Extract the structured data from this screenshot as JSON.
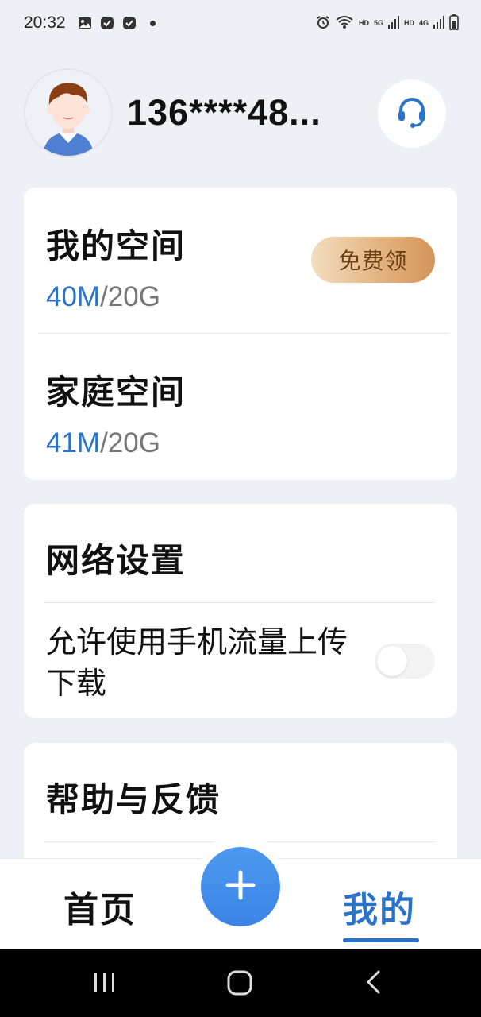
{
  "status_bar": {
    "time": "20:32",
    "right_labels": [
      "HD",
      "5G",
      "HD",
      "4G"
    ]
  },
  "profile": {
    "phone": "136****48..."
  },
  "storage": {
    "my_space": {
      "title": "我的空间",
      "used": "40M",
      "total": "/20G"
    },
    "claim_button": "免费领",
    "family_space": {
      "title": "家庭空间",
      "used": "41M",
      "total": "/20G"
    }
  },
  "network": {
    "title": "网络设置",
    "mobile_data_label": "允许使用手机流量上传下载",
    "mobile_data_enabled": false
  },
  "help": {
    "title": "帮助与反馈"
  },
  "bottom_nav": {
    "home": "首页",
    "mine": "我的",
    "active": "mine"
  },
  "colors": {
    "accent": "#2a73c9",
    "background": "#eff0f5",
    "claim_gradient_end": "#d4955a"
  }
}
